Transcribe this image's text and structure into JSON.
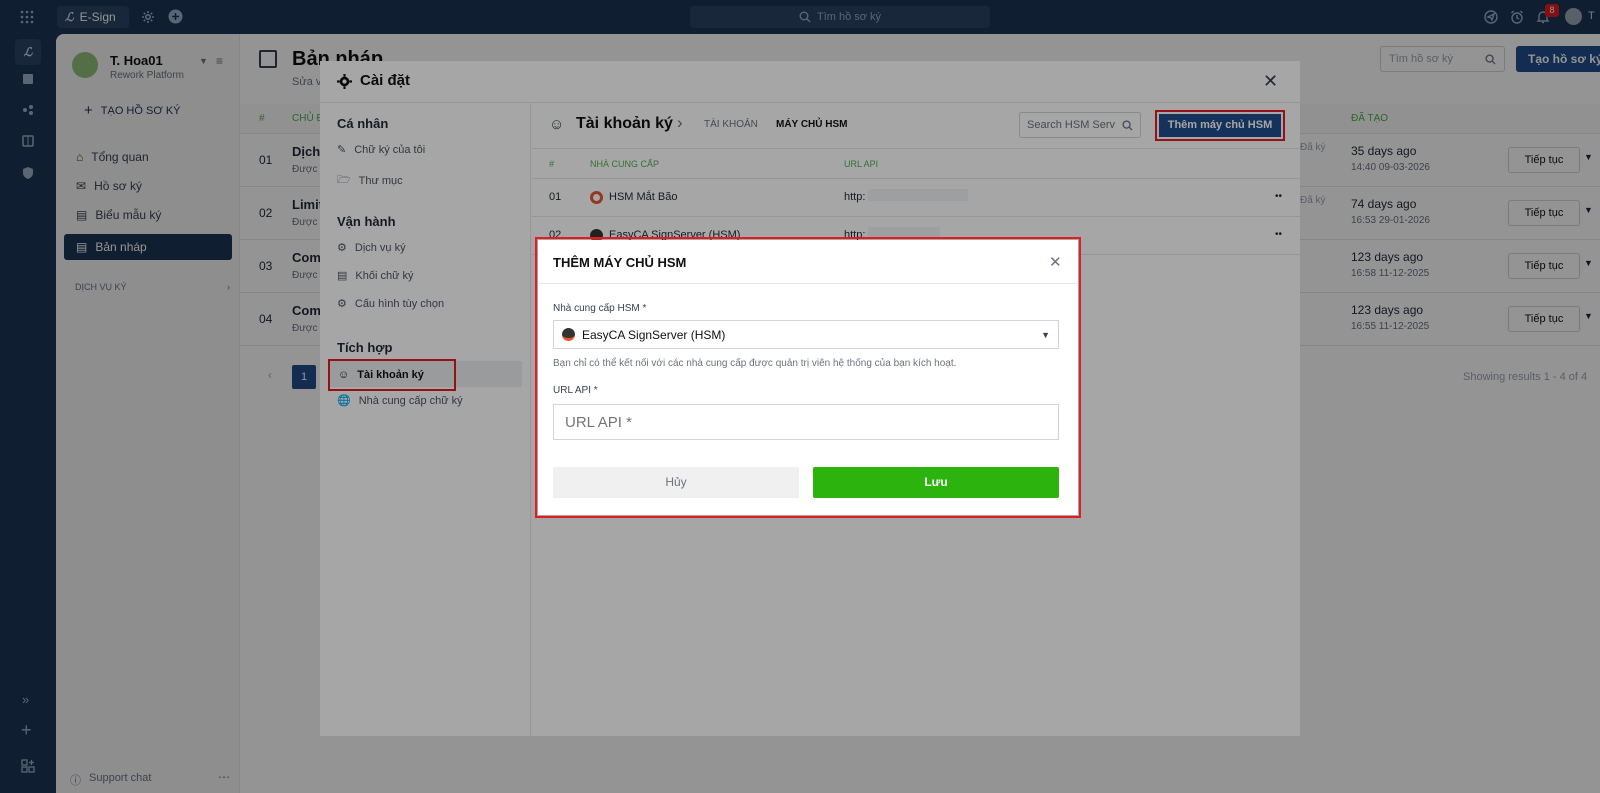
{
  "topbar": {
    "app_name": "E-Sign",
    "search_placeholder": "Tìm hồ sơ ký",
    "notif_count": "8",
    "user_initial": "T"
  },
  "sidebar": {
    "user_name": "T. Hoa01",
    "org": "Rework Platform",
    "create_btn": "TẠO HỒ SƠ KÝ",
    "items": [
      {
        "label": "Tổng quan"
      },
      {
        "label": "Hồ sơ ký"
      },
      {
        "label": "Biểu mẫu ký"
      },
      {
        "label": "Bản nháp"
      }
    ],
    "section": "DỊCH VỤ KÝ",
    "support": "Support chat"
  },
  "main": {
    "title": "Bản nháp",
    "subtitle": "Sửa v",
    "search_placeholder": "Tìm hồ sơ ký",
    "create_btn": "Tạo hồ sơ ký",
    "col_no": "#",
    "col_owner": "CHỦ Đ",
    "col_created": "ĐÃ TẠO",
    "rows": [
      {
        "no": "01",
        "title": "Dịch",
        "sub": "Được",
        "status": "Đã ký",
        "ago": "35 days ago",
        "date": "14:40 09-03-2026",
        "action": "Tiếp tục"
      },
      {
        "no": "02",
        "title": "Limit",
        "sub": "Được",
        "status": "Đã ký",
        "ago": "74 days ago",
        "date": "16:53 29-01-2026",
        "action": "Tiếp tục"
      },
      {
        "no": "03",
        "title": "Com",
        "sub": "Được",
        "status": "",
        "ago": "123 days ago",
        "date": "16:58 11-12-2025",
        "action": "Tiếp tục"
      },
      {
        "no": "04",
        "title": "Com",
        "sub": "Được",
        "status": "",
        "ago": "123 days ago",
        "date": "16:55 11-12-2025",
        "action": "Tiếp tục"
      }
    ],
    "page": "1",
    "results": "Showing results 1 - 4 of 4"
  },
  "settings": {
    "title": "Cài đặt",
    "groups": [
      {
        "title": "Cá nhân",
        "items": [
          "Chữ ký của tôi",
          "Thư mục"
        ]
      },
      {
        "title": "Vận hành",
        "items": [
          "Dịch vụ ký",
          "Khối chữ ký",
          "Cấu hình tùy chọn"
        ]
      },
      {
        "title": "Tích hợp",
        "items": [
          "Tài khoản ký",
          "Nhà cung cấp chữ ký"
        ]
      }
    ],
    "section_title": "Tài khoản ký",
    "tab_accounts": "TÀI KHOẢN",
    "tab_hsm": "MÁY CHỦ HSM",
    "search_placeholder": "Search HSM Serv",
    "add_btn": "Thêm máy chủ HSM",
    "col_no": "#",
    "col_provider": "NHÀ CUNG CẤP",
    "col_url": "URL API",
    "rows": [
      {
        "no": "01",
        "provider": "HSM Mắt Bão",
        "url": "http:"
      },
      {
        "no": "02",
        "provider": "EasyCA SignServer (HSM)",
        "url": "http:"
      }
    ]
  },
  "dialog": {
    "title": "THÊM MÁY CHỦ HSM",
    "provider_label": "Nhà cung cấp HSM *",
    "provider_value": "EasyCA SignServer (HSM)",
    "hint": "Bạn chỉ có thể kết nối với các nhà cung cấp được quản trị viên hệ thống của bạn kích hoạt.",
    "url_label": "URL API *",
    "url_placeholder": "URL API *",
    "cancel": "Hủy",
    "save": "Lưu"
  },
  "colors": {
    "navy": "#1d3557",
    "primary": "#1f4e8c",
    "save_green": "#2db30d",
    "highlight": "#e31b23",
    "green_text": "#4caf50"
  }
}
